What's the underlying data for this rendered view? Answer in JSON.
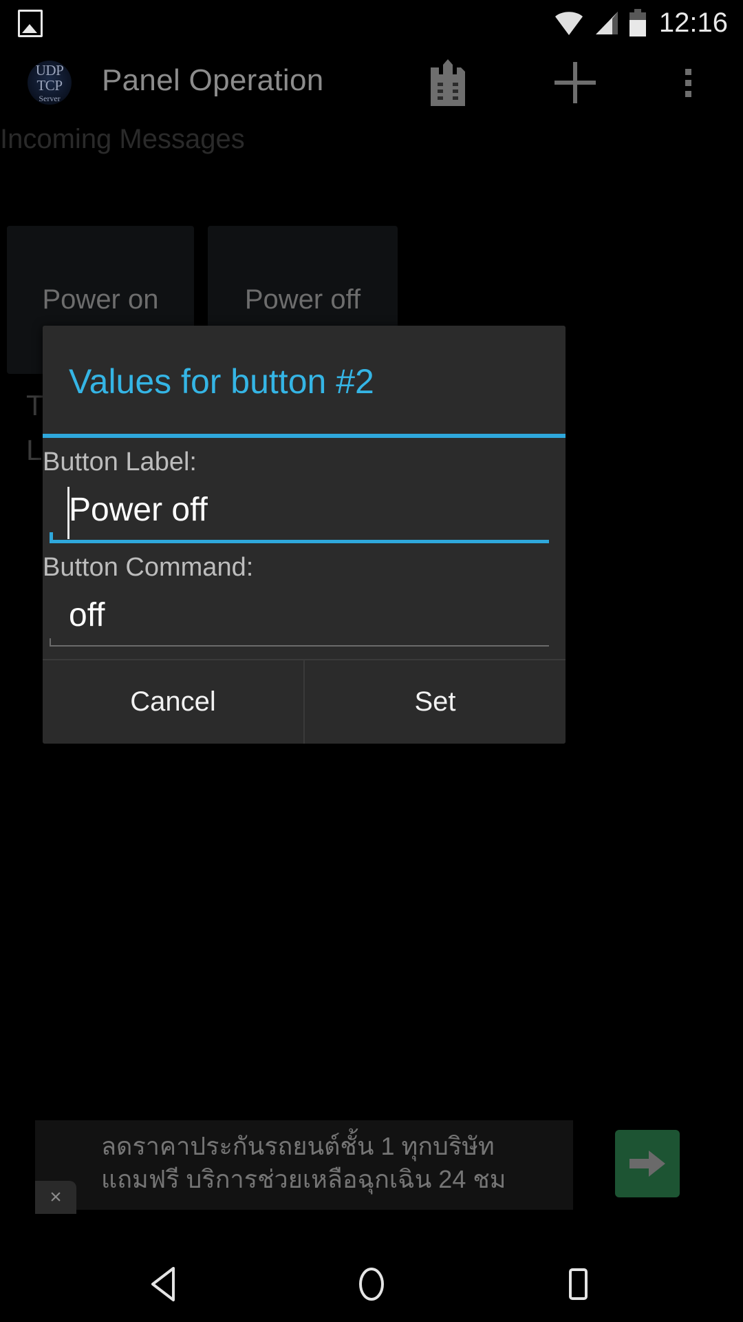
{
  "status_bar": {
    "photo_icon": "photo-icon",
    "wifi_icon": "wifi-icon",
    "signal_icon": "cellular-signal-icon",
    "battery_icon": "battery-icon",
    "clock": "12:16"
  },
  "app_bar": {
    "logo_line1": "UDP",
    "logo_line2": "TCP",
    "logo_line3": "Server",
    "title": "Panel Operation",
    "save_icon": "save-document-icon",
    "add_icon": "plus-icon",
    "overflow_icon": "overflow-menu-icon"
  },
  "main": {
    "section_label": "Incoming Messages",
    "panel_buttons": [
      {
        "label": "Power on"
      },
      {
        "label": "Power off"
      }
    ],
    "obscured_text": [
      "T",
      "L"
    ]
  },
  "dialog": {
    "title": "Values for button #2",
    "accent_color": "#2fa8dc",
    "title_color": "#35b5e5",
    "fields": [
      {
        "label": "Button Label:",
        "value": "Power off",
        "focused": true
      },
      {
        "label": "Button Command:",
        "value": "off",
        "focused": false
      }
    ],
    "cancel_label": "Cancel",
    "set_label": "Set"
  },
  "ad": {
    "line1": "ลดราคาประกันรถยนต์ชั้น 1 ทุกบริษัท",
    "line2": "แถมฟรี บริการช่วยเหลือฉุกเฉิน 24 ชม",
    "close_label": "×",
    "cta_icon": "arrow-right-icon",
    "cta_color": "#1d5433"
  },
  "nav_bar": {
    "back_icon": "back-triangle-icon",
    "home_icon": "home-circle-icon",
    "recents_icon": "recents-square-icon"
  }
}
